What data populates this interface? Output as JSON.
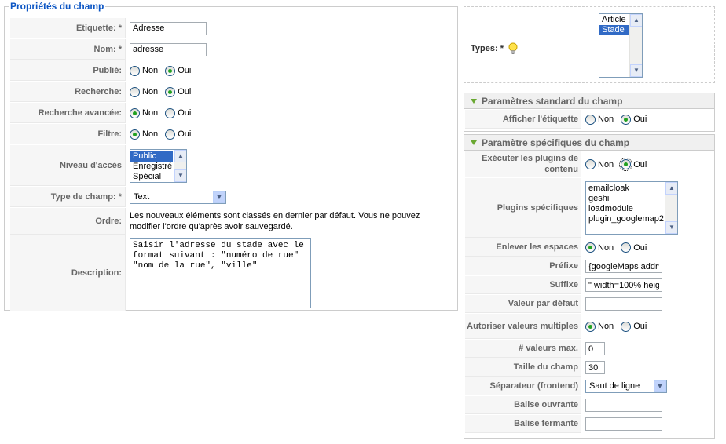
{
  "properties": {
    "legend": "Propriétés du champ",
    "label_field": {
      "label": "Etiquette: *",
      "value": "Adresse"
    },
    "name_field": {
      "label": "Nom: *",
      "value": "adresse"
    },
    "published": {
      "label": "Publié:",
      "no": "Non",
      "yes": "Oui",
      "selected": "yes"
    },
    "search": {
      "label": "Recherche:",
      "no": "Non",
      "yes": "Oui",
      "selected": "yes"
    },
    "advanced_search": {
      "label": "Recherche avancée:",
      "no": "Non",
      "yes": "Oui",
      "selected": "no"
    },
    "filter": {
      "label": "Filtre:",
      "no": "Non",
      "yes": "Oui",
      "selected": "no"
    },
    "access": {
      "label": "Niveau d'accès",
      "options": [
        "Public",
        "Enregistré",
        "Spécial"
      ],
      "selected": "Public"
    },
    "field_type": {
      "label": "Type de champ: *",
      "value": "Text"
    },
    "order": {
      "label": "Ordre:",
      "note": "Les nouveaux éléments sont classés en dernier par défaut. Vous ne pouvez modifier l'ordre qu'après avoir sauvegardé."
    },
    "description": {
      "label": "Description:",
      "value": "Saisir l'adresse du stade avec le format suivant : \"numéro de rue\" \"nom de la rue\", \"ville\""
    }
  },
  "types": {
    "label": "Types: *",
    "options": [
      "Article",
      "Stade"
    ],
    "selected": "Stade",
    "icon": "lightbulb-icon"
  },
  "standard": {
    "title": "Paramètres standard du champ",
    "show_label": {
      "label": "Afficher l'étiquette",
      "no": "Non",
      "yes": "Oui",
      "selected": "yes"
    }
  },
  "specific": {
    "title": "Paramètre spécifiques du champ",
    "run_plugins": {
      "label": "Exécuter les plugins de contenu",
      "no": "Non",
      "yes": "Oui",
      "selected": "yes"
    },
    "plugins": {
      "label": "Plugins spécifiques",
      "options": [
        "emailcloak",
        "geshi",
        "loadmodule",
        "plugin_googlemap2"
      ]
    },
    "trim": {
      "label": "Enlever les espaces",
      "no": "Non",
      "yes": "Oui",
      "selected": "no"
    },
    "prefix": {
      "label": "Préfixe",
      "value": "{googleMaps addr=\""
    },
    "suffix": {
      "label": "Suffixe",
      "value": "\" width=100% heigh"
    },
    "default_value": {
      "label": "Valeur par défaut",
      "value": ""
    },
    "multiple": {
      "label": "Autoriser valeurs multiples",
      "no": "Non",
      "yes": "Oui",
      "selected": "no"
    },
    "max_values": {
      "label": "# valeurs max.",
      "value": "0"
    },
    "field_size": {
      "label": "Taille du champ",
      "value": "30"
    },
    "separator": {
      "label": "Séparateur (frontend)",
      "value": "Saut de ligne"
    },
    "open_tag": {
      "label": "Balise ouvrante",
      "value": ""
    },
    "close_tag": {
      "label": "Balise fermante",
      "value": ""
    }
  }
}
